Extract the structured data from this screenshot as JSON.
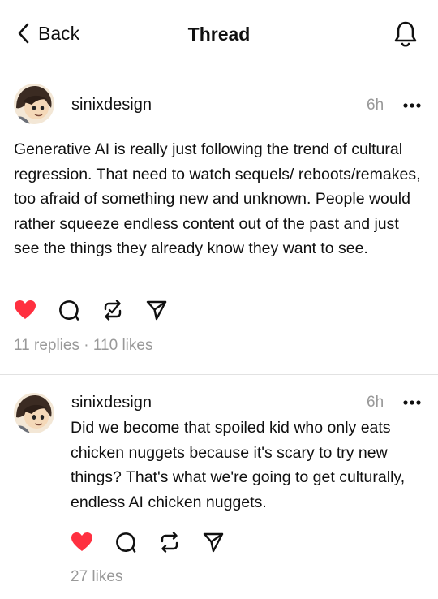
{
  "header": {
    "back_label": "Back",
    "title": "Thread",
    "icons": {
      "back": "chevron-left-icon",
      "notifications": "bell-icon"
    }
  },
  "posts": [
    {
      "username": "sinixdesign",
      "time": "6h",
      "text": "Generative AI is really just following the trend of cultural regression. That need to watch sequels/ reboots/remakes, too afraid of something new and unknown.  People would rather squeeze endless content out of the past and just see the things they already know they want to see.",
      "liked": true,
      "replies_text": "11 replies",
      "separator": "·",
      "likes_text": "110 likes"
    },
    {
      "username": "sinixdesign",
      "time": "6h",
      "text": "Did we become that spoiled kid who only eats chicken nuggets because it's scary to try new things?  That's what we're going to get culturally, endless AI chicken nuggets.",
      "liked": true,
      "likes_text": "27 likes"
    }
  ],
  "colors": {
    "like_red": "#ff3040",
    "text": "#101010",
    "muted": "#999999",
    "divider": "#e2e2e2"
  }
}
